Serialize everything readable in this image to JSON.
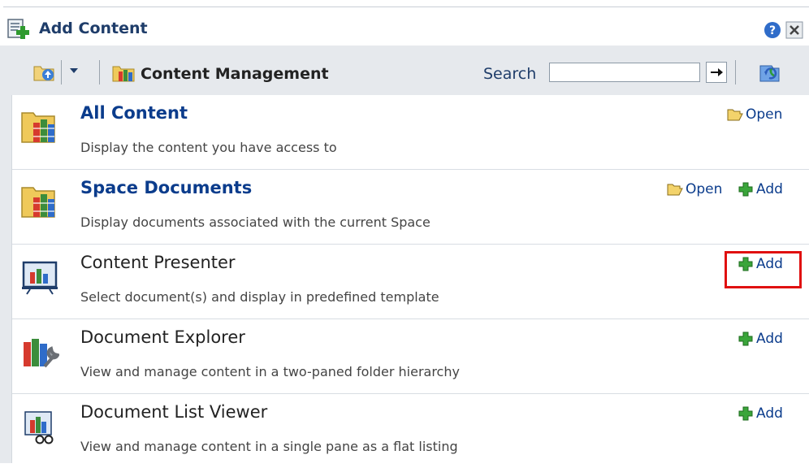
{
  "dialog": {
    "title": "Add Content"
  },
  "toolbar": {
    "location_label": "Content Management",
    "search_label": "Search",
    "search_value": "",
    "search_placeholder": ""
  },
  "items": [
    {
      "title": "All Content",
      "description": "Display the content you have access to",
      "open_label": "Open"
    },
    {
      "title": "Space Documents",
      "description": "Display documents associated with the current Space",
      "open_label": "Open",
      "add_label": "Add"
    },
    {
      "title": "Content Presenter",
      "description": "Select document(s) and display in predefined template",
      "add_label": "Add"
    },
    {
      "title": "Document Explorer",
      "description": "View and manage content in a two-paned folder hierarchy",
      "add_label": "Add"
    },
    {
      "title": "Document List Viewer",
      "description": "View and manage content in a single pane as a flat listing",
      "add_label": "Add"
    }
  ],
  "colors": {
    "link": "#0b3c8c",
    "highlight": "#e01010",
    "toolbar_bg": "#e6e9ed"
  },
  "icons": {
    "title": "add-content-icon",
    "help": "help-icon",
    "close": "close-icon",
    "folder_up": "folder-up-icon",
    "dropdown": "chevron-down-icon",
    "content_management": "library-icon",
    "go": "arrow-right-icon",
    "refresh": "refresh-icon",
    "open": "folder-open-icon",
    "add": "plus-icon"
  }
}
